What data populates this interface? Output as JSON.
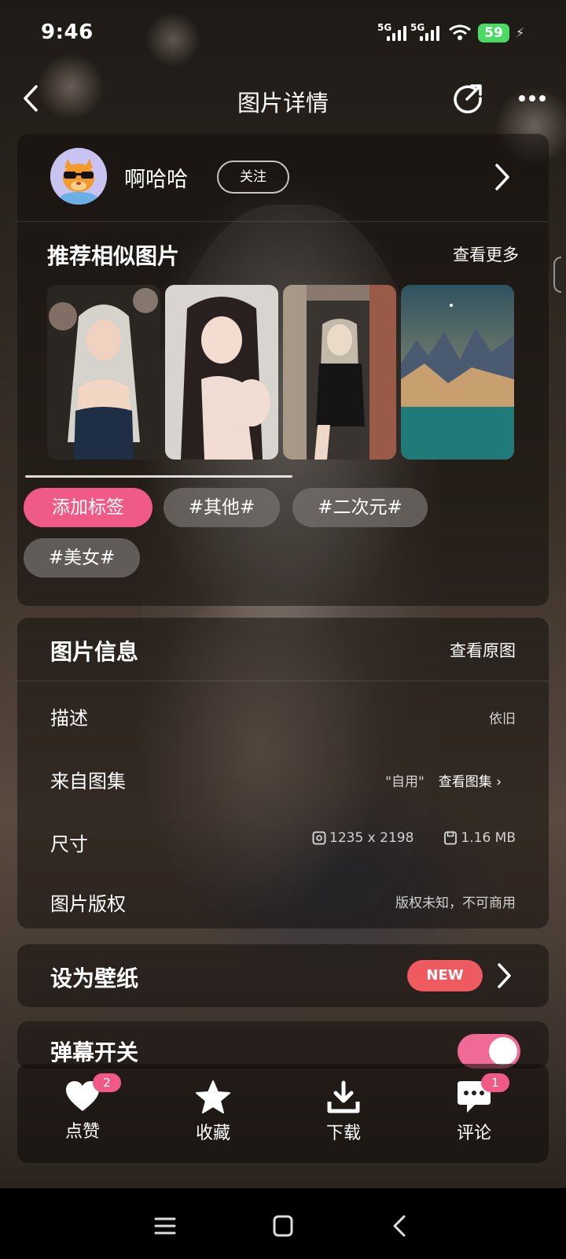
{
  "status_bar": {
    "time": "9:46",
    "signal1": "5G",
    "signal2": "5G",
    "battery": "59"
  },
  "header": {
    "title": "图片详情"
  },
  "author": {
    "name": "啊哈哈",
    "follow_label": "关注"
  },
  "recommend": {
    "title": "推荐相似图片",
    "more_label": "查看更多",
    "thumbnails": [
      "white-haired-girl-photo",
      "black-haired-girl-photo",
      "girl-brick-wall-photo",
      "mountain-landscape-photo"
    ]
  },
  "tags": {
    "add_label": "添加标签",
    "items": [
      "#其他#",
      "#二次元#",
      "#美女#"
    ]
  },
  "info": {
    "title": "图片信息",
    "view_original_label": "查看原图",
    "description_label": "描述",
    "description_value": "依旧",
    "collection_label": "来自图集",
    "collection_value": "\"自用\"",
    "collection_link": "查看图集 ›",
    "size_label": "尺寸",
    "dimensions": "1235 x 2198",
    "file_size": "1.16 MB",
    "copyright_label": "图片版权",
    "copyright_value": "版权未知，不可商用"
  },
  "wallpaper": {
    "label": "设为壁纸",
    "badge": "NEW"
  },
  "danmu": {
    "label": "弹幕开关",
    "enabled": true
  },
  "actions": [
    {
      "label": "点赞",
      "icon": "heart-icon",
      "count": "2"
    },
    {
      "label": "收藏",
      "icon": "star-icon",
      "count": ""
    },
    {
      "label": "下载",
      "icon": "download-icon",
      "count": ""
    },
    {
      "label": "评论",
      "icon": "comment-icon",
      "count": "1"
    }
  ],
  "colors": {
    "accent_pink": "#ef5a86",
    "new_badge": "#ef5a60",
    "battery": "#4cd964"
  }
}
